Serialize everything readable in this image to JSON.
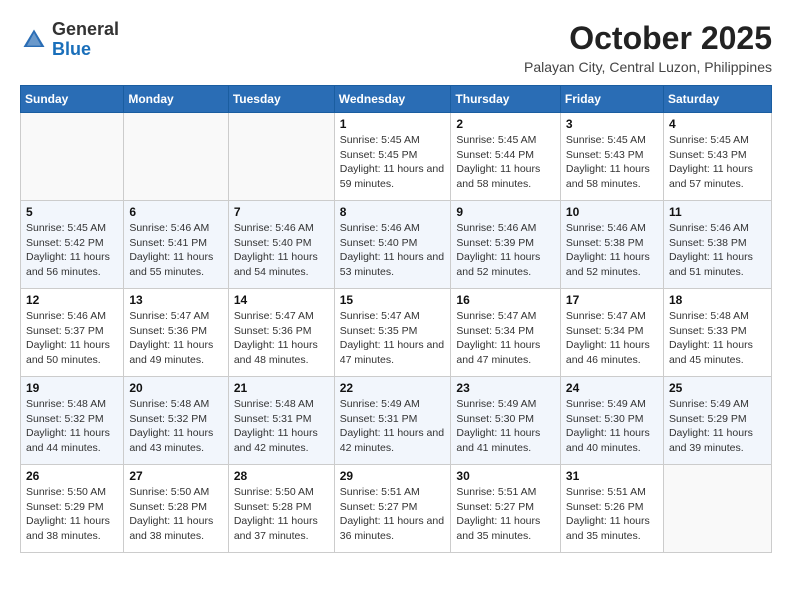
{
  "header": {
    "logo_general": "General",
    "logo_blue": "Blue",
    "month_title": "October 2025",
    "location": "Palayan City, Central Luzon, Philippines"
  },
  "weekdays": [
    "Sunday",
    "Monday",
    "Tuesday",
    "Wednesday",
    "Thursday",
    "Friday",
    "Saturday"
  ],
  "weeks": [
    [
      {
        "day": "",
        "info": ""
      },
      {
        "day": "",
        "info": ""
      },
      {
        "day": "",
        "info": ""
      },
      {
        "day": "1",
        "sunrise": "5:45 AM",
        "sunset": "5:45 PM",
        "daylight": "11 hours and 59 minutes."
      },
      {
        "day": "2",
        "sunrise": "5:45 AM",
        "sunset": "5:44 PM",
        "daylight": "11 hours and 58 minutes."
      },
      {
        "day": "3",
        "sunrise": "5:45 AM",
        "sunset": "5:43 PM",
        "daylight": "11 hours and 58 minutes."
      },
      {
        "day": "4",
        "sunrise": "5:45 AM",
        "sunset": "5:43 PM",
        "daylight": "11 hours and 57 minutes."
      }
    ],
    [
      {
        "day": "5",
        "sunrise": "5:45 AM",
        "sunset": "5:42 PM",
        "daylight": "11 hours and 56 minutes."
      },
      {
        "day": "6",
        "sunrise": "5:46 AM",
        "sunset": "5:41 PM",
        "daylight": "11 hours and 55 minutes."
      },
      {
        "day": "7",
        "sunrise": "5:46 AM",
        "sunset": "5:40 PM",
        "daylight": "11 hours and 54 minutes."
      },
      {
        "day": "8",
        "sunrise": "5:46 AM",
        "sunset": "5:40 PM",
        "daylight": "11 hours and 53 minutes."
      },
      {
        "day": "9",
        "sunrise": "5:46 AM",
        "sunset": "5:39 PM",
        "daylight": "11 hours and 52 minutes."
      },
      {
        "day": "10",
        "sunrise": "5:46 AM",
        "sunset": "5:38 PM",
        "daylight": "11 hours and 52 minutes."
      },
      {
        "day": "11",
        "sunrise": "5:46 AM",
        "sunset": "5:38 PM",
        "daylight": "11 hours and 51 minutes."
      }
    ],
    [
      {
        "day": "12",
        "sunrise": "5:46 AM",
        "sunset": "5:37 PM",
        "daylight": "11 hours and 50 minutes."
      },
      {
        "day": "13",
        "sunrise": "5:47 AM",
        "sunset": "5:36 PM",
        "daylight": "11 hours and 49 minutes."
      },
      {
        "day": "14",
        "sunrise": "5:47 AM",
        "sunset": "5:36 PM",
        "daylight": "11 hours and 48 minutes."
      },
      {
        "day": "15",
        "sunrise": "5:47 AM",
        "sunset": "5:35 PM",
        "daylight": "11 hours and 47 minutes."
      },
      {
        "day": "16",
        "sunrise": "5:47 AM",
        "sunset": "5:34 PM",
        "daylight": "11 hours and 47 minutes."
      },
      {
        "day": "17",
        "sunrise": "5:47 AM",
        "sunset": "5:34 PM",
        "daylight": "11 hours and 46 minutes."
      },
      {
        "day": "18",
        "sunrise": "5:48 AM",
        "sunset": "5:33 PM",
        "daylight": "11 hours and 45 minutes."
      }
    ],
    [
      {
        "day": "19",
        "sunrise": "5:48 AM",
        "sunset": "5:32 PM",
        "daylight": "11 hours and 44 minutes."
      },
      {
        "day": "20",
        "sunrise": "5:48 AM",
        "sunset": "5:32 PM",
        "daylight": "11 hours and 43 minutes."
      },
      {
        "day": "21",
        "sunrise": "5:48 AM",
        "sunset": "5:31 PM",
        "daylight": "11 hours and 42 minutes."
      },
      {
        "day": "22",
        "sunrise": "5:49 AM",
        "sunset": "5:31 PM",
        "daylight": "11 hours and 42 minutes."
      },
      {
        "day": "23",
        "sunrise": "5:49 AM",
        "sunset": "5:30 PM",
        "daylight": "11 hours and 41 minutes."
      },
      {
        "day": "24",
        "sunrise": "5:49 AM",
        "sunset": "5:30 PM",
        "daylight": "11 hours and 40 minutes."
      },
      {
        "day": "25",
        "sunrise": "5:49 AM",
        "sunset": "5:29 PM",
        "daylight": "11 hours and 39 minutes."
      }
    ],
    [
      {
        "day": "26",
        "sunrise": "5:50 AM",
        "sunset": "5:29 PM",
        "daylight": "11 hours and 38 minutes."
      },
      {
        "day": "27",
        "sunrise": "5:50 AM",
        "sunset": "5:28 PM",
        "daylight": "11 hours and 38 minutes."
      },
      {
        "day": "28",
        "sunrise": "5:50 AM",
        "sunset": "5:28 PM",
        "daylight": "11 hours and 37 minutes."
      },
      {
        "day": "29",
        "sunrise": "5:51 AM",
        "sunset": "5:27 PM",
        "daylight": "11 hours and 36 minutes."
      },
      {
        "day": "30",
        "sunrise": "5:51 AM",
        "sunset": "5:27 PM",
        "daylight": "11 hours and 35 minutes."
      },
      {
        "day": "31",
        "sunrise": "5:51 AM",
        "sunset": "5:26 PM",
        "daylight": "11 hours and 35 minutes."
      },
      {
        "day": "",
        "info": ""
      }
    ]
  ],
  "labels": {
    "sunrise": "Sunrise:",
    "sunset": "Sunset:",
    "daylight": "Daylight:"
  }
}
